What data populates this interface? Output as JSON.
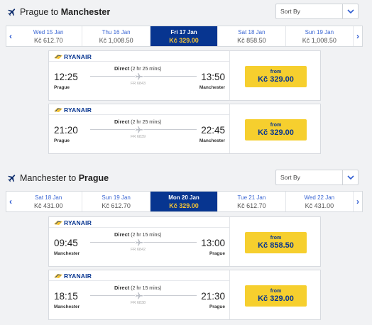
{
  "outbound": {
    "title_from": "Prague",
    "title_to_word": "to",
    "title_to": "Manchester",
    "sort_label": "Sort By",
    "dates": [
      {
        "day": "Wed 15 Jan",
        "price": "Kč 612.70",
        "selected": false
      },
      {
        "day": "Thu 16 Jan",
        "price": "Kč 1,008.50",
        "selected": false
      },
      {
        "day": "Fri 17 Jan",
        "price": "Kč 329.00",
        "selected": true
      },
      {
        "day": "Sat 18 Jan",
        "price": "Kč 858.50",
        "selected": false
      },
      {
        "day": "Sun 19 Jan",
        "price": "Kč 1,008.50",
        "selected": false
      }
    ],
    "flights": [
      {
        "airline": "RYANAIR",
        "dep_time": "12:25",
        "dep_city": "Prague",
        "arr_time": "13:50",
        "arr_city": "Manchester",
        "direct": "Direct",
        "duration": "(2 hr 25 mins)",
        "flight_no": "FR 6843",
        "from_label": "from",
        "price": "Kč 329.00"
      },
      {
        "airline": "RYANAIR",
        "dep_time": "21:20",
        "dep_city": "Prague",
        "arr_time": "22:45",
        "arr_city": "Manchester",
        "direct": "Direct",
        "duration": "(2 hr 25 mins)",
        "flight_no": "FR 6839",
        "from_label": "from",
        "price": "Kč 329.00"
      }
    ]
  },
  "return": {
    "title_from": "Manchester",
    "title_to_word": "to",
    "title_to": "Prague",
    "sort_label": "Sort By",
    "dates": [
      {
        "day": "Sat 18 Jan",
        "price": "Kč 431.00",
        "selected": false
      },
      {
        "day": "Sun 19 Jan",
        "price": "Kč 612.70",
        "selected": false
      },
      {
        "day": "Mon 20 Jan",
        "price": "Kč 329.00",
        "selected": true
      },
      {
        "day": "Tue 21 Jan",
        "price": "Kč 612.70",
        "selected": false
      },
      {
        "day": "Wed 22 Jan",
        "price": "Kč 431.00",
        "selected": false
      }
    ],
    "flights": [
      {
        "airline": "RYANAIR",
        "dep_time": "09:45",
        "dep_city": "Manchester",
        "arr_time": "13:00",
        "arr_city": "Prague",
        "direct": "Direct",
        "duration": "(2 hr 15 mins)",
        "flight_no": "FR 6842",
        "from_label": "from",
        "price": "Kč 858.50"
      },
      {
        "airline": "RYANAIR",
        "dep_time": "18:15",
        "dep_city": "Manchester",
        "arr_time": "21:30",
        "arr_city": "Prague",
        "direct": "Direct",
        "duration": "(2 hr 15 mins)",
        "flight_no": "FR 6838",
        "from_label": "from",
        "price": "Kč 329.00"
      }
    ]
  },
  "icons": {
    "plane": "plane-icon",
    "chevron": "chevron-down-icon",
    "prev": "chevron-left-icon",
    "next": "chevron-right-icon",
    "airline_logo": "ryanair-harp-icon"
  },
  "colors": {
    "brand_blue": "#073590",
    "accent_yellow": "#f6cf2e",
    "price_yellow": "#f6c433",
    "link_blue": "#3a66d3"
  }
}
